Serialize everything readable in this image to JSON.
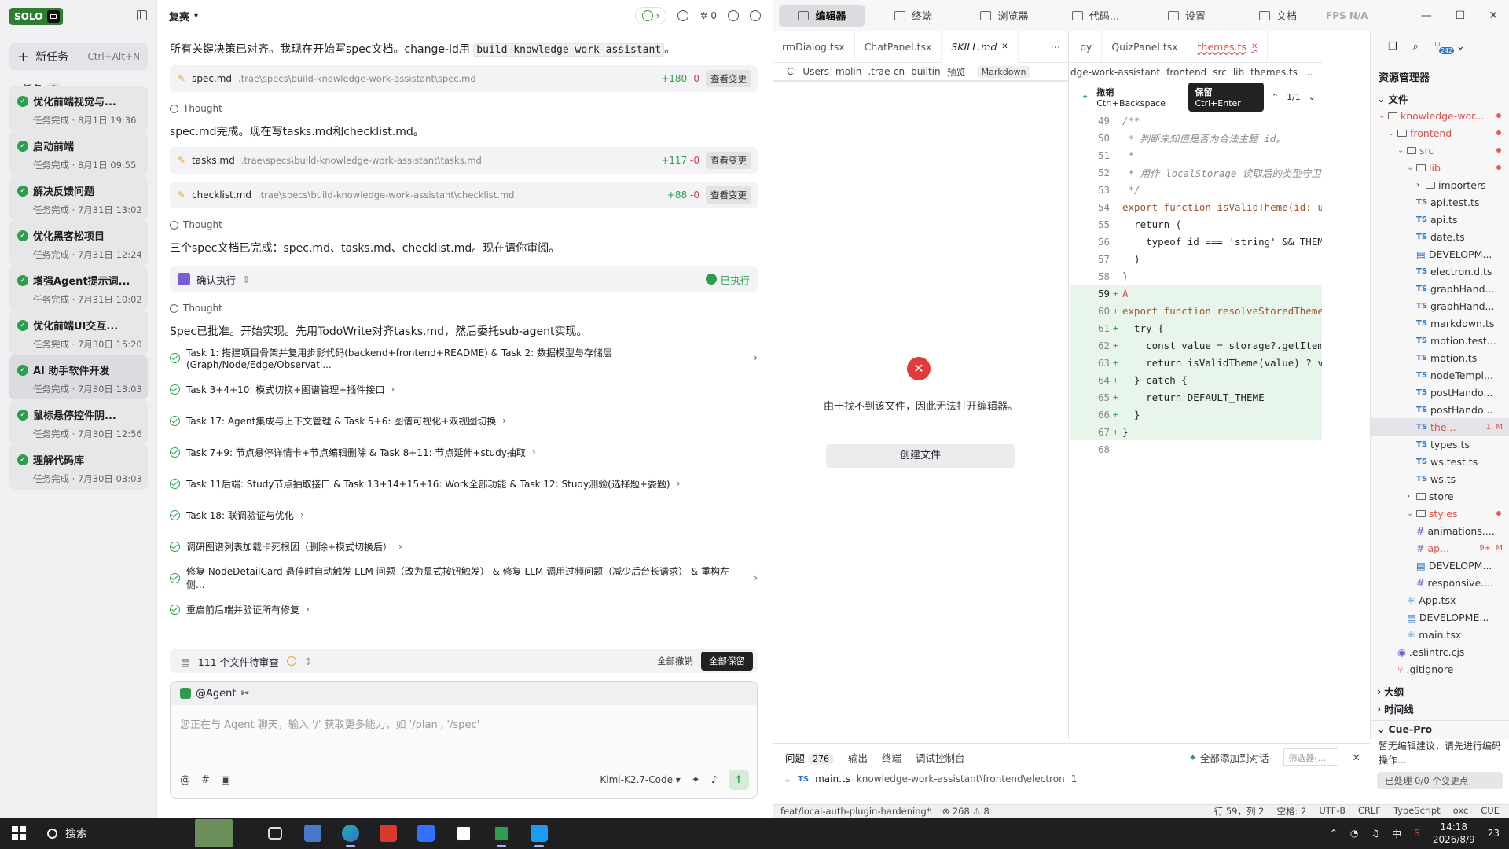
{
  "sidebar": {
    "brand": "SOLO",
    "new_task": {
      "label": "新任务",
      "shortcut": "Ctrl+Alt+N"
    },
    "tasks_label": "任务",
    "tasks_count": "9",
    "items": [
      {
        "title": "优化前端视觉与...",
        "status": "任务完成 · 8月1日 19:36"
      },
      {
        "title": "启动前端",
        "status": "任务完成 · 8月1日 09:55"
      },
      {
        "title": "解决反馈问题",
        "status": "任务完成 · 7月31日 13:02"
      },
      {
        "title": "优化黑客松项目",
        "status": "任务完成 · 7月31日 12:24"
      },
      {
        "title": "增强Agent提示词...",
        "status": "任务完成 · 7月31日 10:02"
      },
      {
        "title": "优化前端UI交互...",
        "status": "任务完成 · 7月30日 15:20"
      },
      {
        "title": "AI 助手软件开发",
        "status": "任务完成 · 7月30日 13:03"
      },
      {
        "title": "鼠标悬停控件阴...",
        "status": "任务完成 · 7月30日 12:56"
      },
      {
        "title": "理解代码库",
        "status": "任务完成 · 7月30日 03:03"
      }
    ]
  },
  "chat": {
    "title": "复赛",
    "star_count": "0",
    "intro_text": "所有关键决策已对齐。我现在开始写spec文档。change-id用",
    "change_id": "build-knowledge-work-assistant",
    "period": "。",
    "files": [
      {
        "name": "spec.md",
        "path": ".trae\\specs\\build-knowledge-work-assistant\\spec.md",
        "add": "+180",
        "del": "-0",
        "btn": "查看变更"
      },
      {
        "name": "tasks.md",
        "path": ".trae\\specs\\build-knowledge-work-assistant\\tasks.md",
        "add": "+117",
        "del": "-0",
        "btn": "查看变更"
      },
      {
        "name": "checklist.md",
        "path": ".trae\\specs\\build-knowledge-work-assistant\\checklist.md",
        "add": "+88",
        "del": "-0",
        "btn": "查看变更"
      }
    ],
    "thought": "Thought",
    "msg_spec_done": "spec.md完成。现在写tasks.md和checklist.md。",
    "msg_three_done": "三个spec文档已完成：spec.md、tasks.md、checklist.md。现在请你审阅。",
    "confirm_label": "确认执行",
    "confirm_status": "已执行",
    "msg_approved": "Spec已批准。开始实现。先用TodoWrite对齐tasks.md，然后委托sub-agent实现。",
    "todos": [
      "Task 1: 搭建项目骨架并复用步影代码(backend+frontend+README) & Task 2: 数据模型与存储层(Graph/Node/Edge/Observati...",
      "Task 3+4+10: 模式切换+图谱管理+插件接口",
      "Task 17: Agent集成与上下文管理 & Task 5+6: 图谱可视化+双视图切换",
      "Task 7+9: 节点悬停详情卡+节点编辑删除 & Task 8+11: 节点延伸+study抽取",
      "Task 11后端: Study节点抽取接口 & Task 13+14+15+16: Work全部功能 & Task 12: Study测验(选择题+委题)",
      "Task 18: 联调验证与优化",
      "调研图谱列表加载卡死根因（删除+模式切换后）",
      "修复 NodeDetailCard 悬停时自动触发 LLM 问题（改为显式按钮触发） & 修复 LLM 调用过频问题（减少后台长请求） & 重构左侧...",
      "重启前后端并验证所有修复"
    ],
    "review": {
      "label": "111 个文件待审查",
      "undo_all": "全部撤销",
      "keep_all": "全部保留"
    },
    "input": {
      "agent": "@Agent",
      "placeholder": "您正在与 Agent 聊天，输入 '/' 获取更多能力，如 '/plan', '/spec'",
      "model": "Kimi-K2.7-Code"
    }
  },
  "editor": {
    "top_tabs": [
      "编辑器",
      "终端",
      "浏览器",
      "代码...",
      "设置",
      "文档"
    ],
    "fps": "FPS N/A",
    "mid_tabs": [
      "rmDialog.tsx",
      "ChatPanel.tsx",
      "SKILL.md"
    ],
    "mid_crumbs": [
      "C:",
      "Users",
      "molin",
      ".trae-cn",
      "builtin",
      "预览"
    ],
    "mid_badge": "Markdown",
    "error_msg": "由于找不到该文件，因此无法打开编辑器。",
    "create_btn": "创建文件",
    "code_tabs": [
      "py",
      "QuizPanel.tsx",
      "themes.ts"
    ],
    "code_crumbs": [
      "dge-work-assistant",
      "frontend",
      "src",
      "lib",
      "themes.ts",
      "..."
    ],
    "diff": {
      "undo": "撤销",
      "undo_kbd": "Ctrl+Backspace",
      "keep": "保留",
      "keep_kbd": "Ctrl+Enter",
      "pos": "1/1"
    },
    "lines": [
      {
        "n": "49",
        "t": "/**"
      },
      {
        "n": "50",
        "t": " * 判断未知值是否为合法主题 id。"
      },
      {
        "n": "51",
        "t": " *"
      },
      {
        "n": "52",
        "t": " * 用作 localStorage 读取后的类型守卫，避免"
      },
      {
        "n": "53",
        "t": " */"
      },
      {
        "n": "54",
        "t": "export function isValidTheme(id: unknown"
      },
      {
        "n": "55",
        "t": "  return ("
      },
      {
        "n": "56",
        "t": "    typeof id === 'string' && THEMES.so"
      },
      {
        "n": "57",
        "t": "  )"
      },
      {
        "n": "58",
        "t": "}"
      },
      {
        "n": "59",
        "t": "A"
      },
      {
        "n": "60",
        "t": "export function resolveStoredTheme(stora"
      },
      {
        "n": "61",
        "t": "  try {"
      },
      {
        "n": "62",
        "t": "    const value = storage?.getItem(THEME"
      },
      {
        "n": "63",
        "t": "    return isValidTheme(value) ? value :"
      },
      {
        "n": "64",
        "t": "  } catch {"
      },
      {
        "n": "65",
        "t": "    return DEFAULT_THEME"
      },
      {
        "n": "66",
        "t": "  }"
      },
      {
        "n": "67",
        "t": "}"
      },
      {
        "n": "68",
        "t": ""
      }
    ],
    "panel": {
      "tabs": [
        "问题",
        "输出",
        "终端",
        "调试控制台"
      ],
      "problem_count": "276",
      "add_all": "全部添加到对话",
      "filter_ph": "筛选器(...",
      "row_file": "main.ts",
      "row_path": "knowledge-work-assistant\\frontend\\electron",
      "row_count": "1"
    }
  },
  "explorer": {
    "title": "资源管理器",
    "files_label": "文件",
    "badge": "242",
    "tree": [
      {
        "d": 0,
        "t": "folder",
        "name": "knowledge-wor...",
        "red": true,
        "dot": true
      },
      {
        "d": 1,
        "t": "folder",
        "name": "frontend",
        "red": true,
        "dot": true
      },
      {
        "d": 2,
        "t": "folder",
        "name": "src",
        "red": true,
        "dot": true
      },
      {
        "d": 3,
        "t": "folder",
        "name": "lib",
        "red": true,
        "dot": true
      },
      {
        "d": 4,
        "t": "folder",
        "name": "importers"
      },
      {
        "d": 4,
        "t": "ts",
        "name": "api.test.ts"
      },
      {
        "d": 4,
        "t": "ts",
        "name": "api.ts"
      },
      {
        "d": 4,
        "t": "ts",
        "name": "date.ts"
      },
      {
        "d": 4,
        "t": "file",
        "name": "DEVELOPM..."
      },
      {
        "d": 4,
        "t": "ts",
        "name": "electron.d.ts"
      },
      {
        "d": 4,
        "t": "ts",
        "name": "graphHand..."
      },
      {
        "d": 4,
        "t": "ts",
        "name": "graphHand..."
      },
      {
        "d": 4,
        "t": "ts",
        "name": "markdown.ts"
      },
      {
        "d": 4,
        "t": "ts",
        "name": "motion.test..."
      },
      {
        "d": 4,
        "t": "ts",
        "name": "motion.ts"
      },
      {
        "d": 4,
        "t": "ts",
        "name": "nodeTempl..."
      },
      {
        "d": 4,
        "t": "ts",
        "name": "postHando..."
      },
      {
        "d": 4,
        "t": "ts",
        "name": "postHando..."
      },
      {
        "d": 4,
        "t": "ts",
        "name": "the...",
        "red": true,
        "sel": true,
        "mark": "1, M"
      },
      {
        "d": 4,
        "t": "ts",
        "name": "types.ts"
      },
      {
        "d": 4,
        "t": "ts",
        "name": "ws.test.ts"
      },
      {
        "d": 4,
        "t": "ts",
        "name": "ws.ts"
      },
      {
        "d": 3,
        "t": "folder",
        "name": "store"
      },
      {
        "d": 3,
        "t": "folder",
        "name": "styles",
        "red": true,
        "dot": true
      },
      {
        "d": 4,
        "t": "hash",
        "name": "animations...."
      },
      {
        "d": 4,
        "t": "hash",
        "name": "ap...",
        "red": true,
        "mark": "9+, M"
      },
      {
        "d": 4,
        "t": "file",
        "name": "DEVELOPM..."
      },
      {
        "d": 4,
        "t": "hash",
        "name": "responsive...."
      },
      {
        "d": 3,
        "t": "react",
        "name": "App.tsx"
      },
      {
        "d": 3,
        "t": "file",
        "name": "DEVELOPME..."
      },
      {
        "d": 3,
        "t": "react",
        "name": "main.tsx"
      },
      {
        "d": 2,
        "t": "dot",
        "name": ".eslintrc.cjs"
      },
      {
        "d": 2,
        "t": "git",
        "name": ".gitignore"
      }
    ],
    "outline": "大纲",
    "timeline": "时间线",
    "cue_title": "Cue-Pro",
    "cue_text": "暂无编辑建议，请先进行编码操作...",
    "cue_btn": "已处理 0/0 个变更点"
  },
  "status": {
    "branch": "feat/local-auth-plugin-hardening*",
    "errors": "268",
    "warnings": "8",
    "position": "行 59，列 2",
    "spaces": "空格: 2",
    "encoding": "UTF-8",
    "eol": "CRLF",
    "lang": "TypeScript",
    "osc": "oxc",
    "cue": "CUE"
  },
  "taskbar": {
    "search": "搜索",
    "time": "14:18",
    "date": "2026/8/9",
    "ime": "中",
    "notif": "23"
  }
}
